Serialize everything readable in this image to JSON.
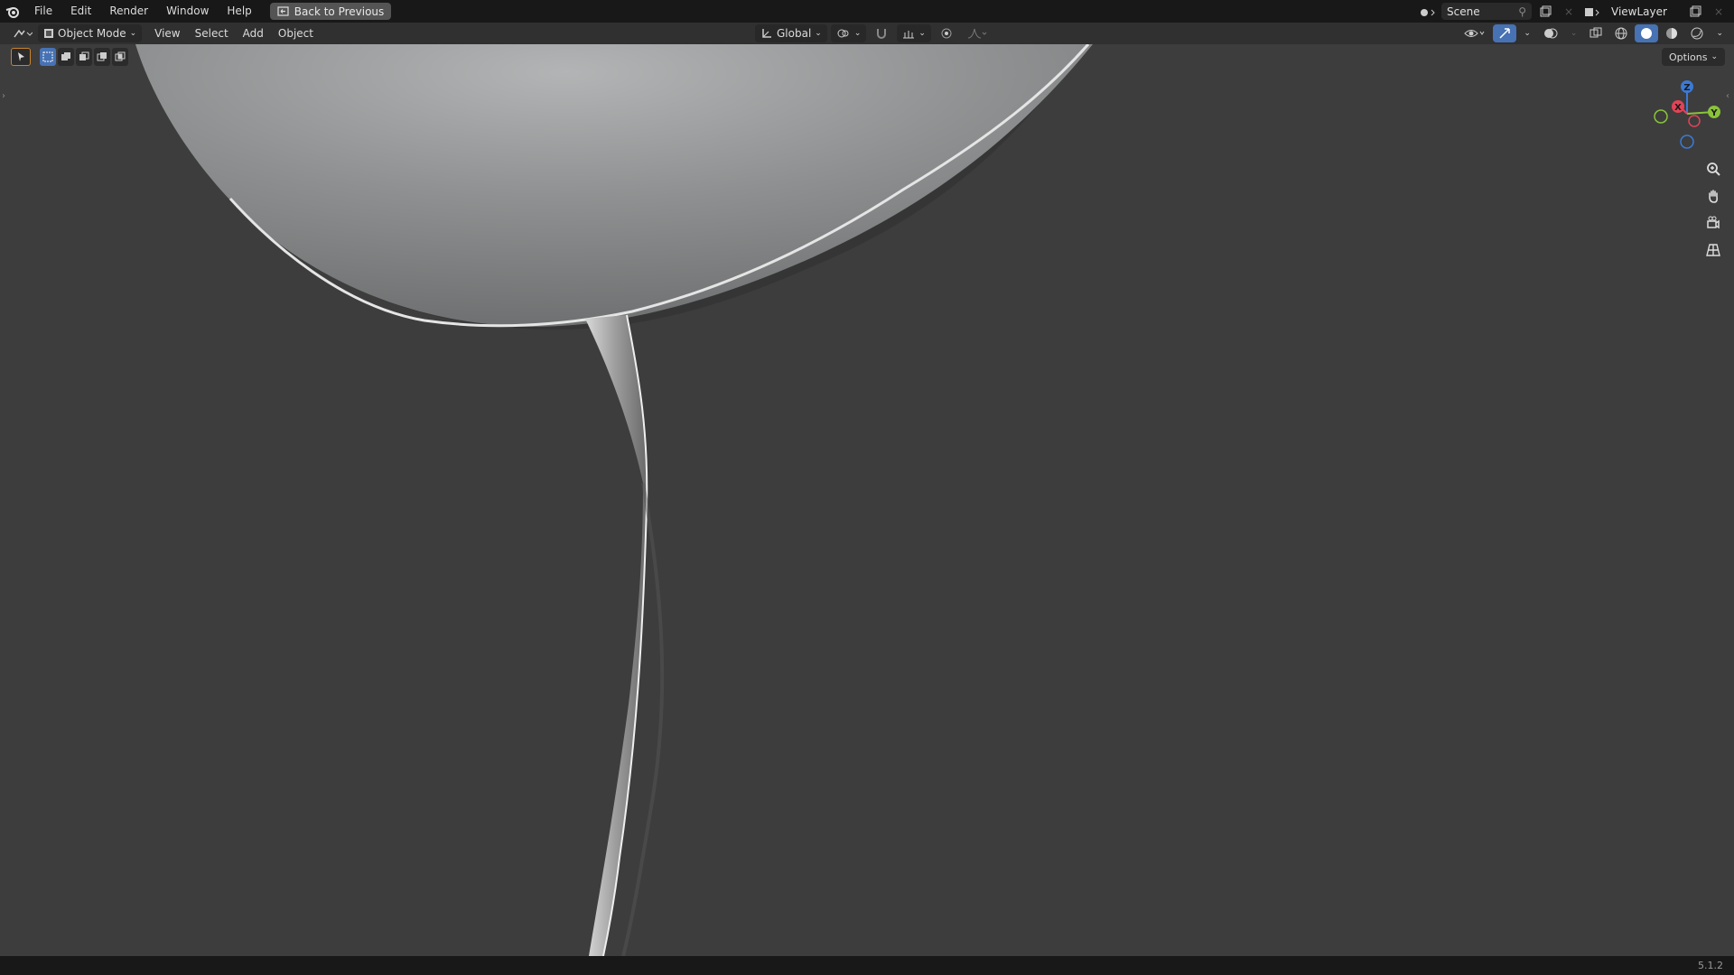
{
  "topbar": {
    "menu": [
      "File",
      "Edit",
      "Render",
      "Window",
      "Help"
    ],
    "back_button": "Back to Previous",
    "scene_name": "Scene",
    "view_layer": "ViewLayer"
  },
  "header": {
    "mode": "Object Mode",
    "menus": [
      "View",
      "Select",
      "Add",
      "Object"
    ],
    "orientation": "Global"
  },
  "viewport": {
    "options_label": "Options",
    "gizmo_axes": {
      "x": "X",
      "y": "Y",
      "z": "Z"
    }
  },
  "statusbar": {
    "version": "5.1.2"
  },
  "colors": {
    "accent": "#4772b3",
    "axis_x": "#e34357",
    "axis_y": "#8ac33a",
    "axis_z": "#3b7ad6",
    "viewport_bg": "#3d3d3d"
  }
}
